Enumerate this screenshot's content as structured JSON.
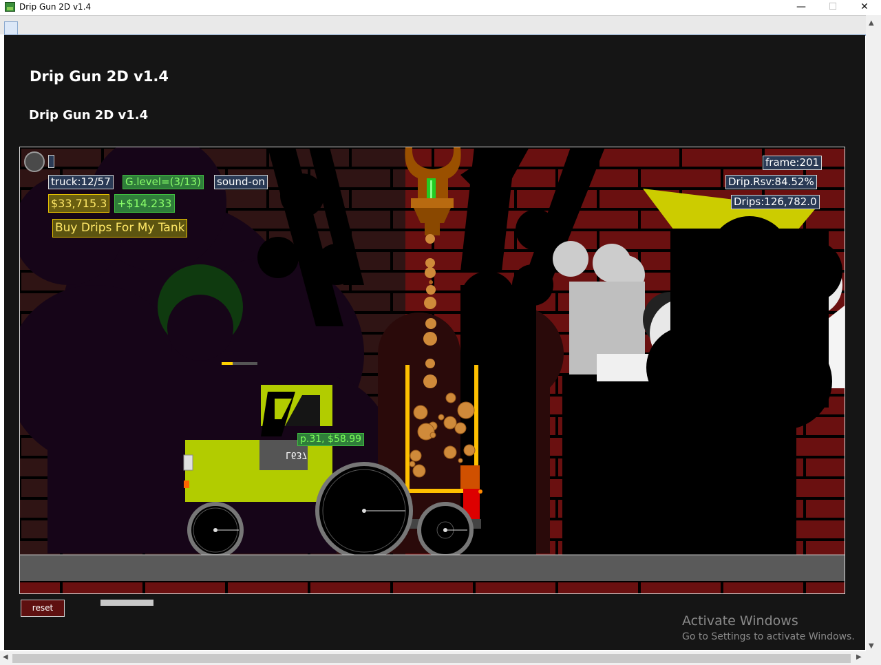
{
  "window": {
    "title": "Drip Gun 2D v1.4",
    "minimize": "—",
    "maximize": "☐",
    "close": "✕"
  },
  "page": {
    "heading1": "Drip Gun 2D v1.4",
    "heading2": "Drip Gun 2D v1.4"
  },
  "hud": {
    "truck": "truck:12/57",
    "glevel": "G.level=(3/13)",
    "sound": "sound-on",
    "money": "$33,715.3",
    "income": "+$14.233",
    "buy": "Buy Drips For My Tank",
    "frame": "frame:201",
    "drip_reserve": "Drip.Rsv:84.52%",
    "drips": "Drips:126,782.0"
  },
  "truck": {
    "plate": "L637",
    "price_label": "p.31, $58.99"
  },
  "controls": {
    "reset": "reset"
  },
  "watermark": {
    "title": "Activate Windows",
    "subtitle": "Go to Settings to activate Windows."
  },
  "colors": {
    "truck_body": "#b2cc00",
    "tank_frame": "#ffc000",
    "drip": "#cf8a3a",
    "brick": "#6a1010",
    "hopper": "#cccc00",
    "nozzle": "#9a5000"
  }
}
